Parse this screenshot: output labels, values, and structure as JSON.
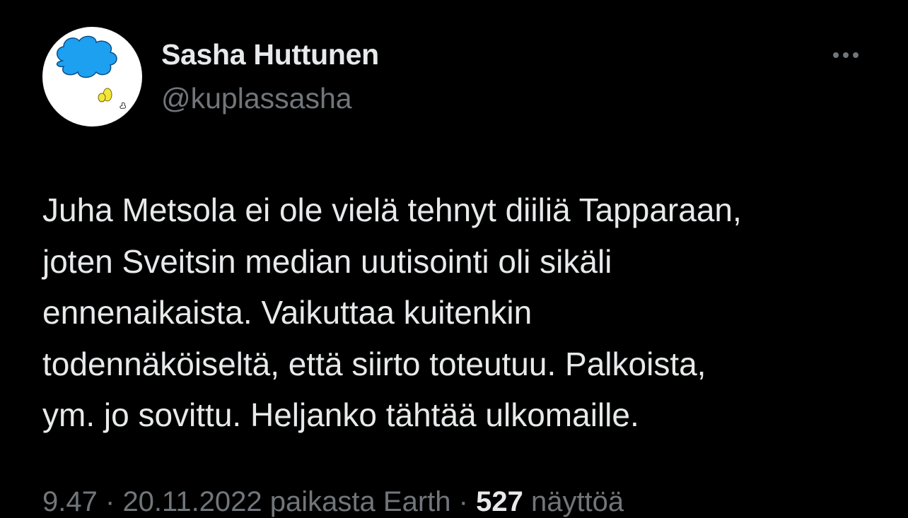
{
  "author": {
    "display_name": "Sasha Huttunen",
    "handle": "@kuplassasha",
    "avatar_icon": "cloud-thought-bubble-icon"
  },
  "more_icon": "more-horizontal-icon",
  "tweet": {
    "lines": [
      "Juha Metsola ei ole vielä tehnyt diiliä Tapparaan,",
      "joten Sveitsin median uutisointi oli sikäli",
      "ennenaikaista. Vaikuttaa kuitenkin",
      "todennäköiseltä, että siirto toteutuu. Palkoista,",
      "ym. jo sovittu. Heljanko tähtää ulkomaille."
    ]
  },
  "meta": {
    "time": "9.47",
    "separator": "·",
    "date": "20.11.2022",
    "source": "paikasta Earth",
    "views_count": "527",
    "views_label": "näyttöä"
  },
  "colors": {
    "background": "#000000",
    "primary_text": "#e7e9ea",
    "secondary_text": "#71767b",
    "cloud_blue": "#1da1f2",
    "bubble_yellow": "#f5e63c"
  }
}
